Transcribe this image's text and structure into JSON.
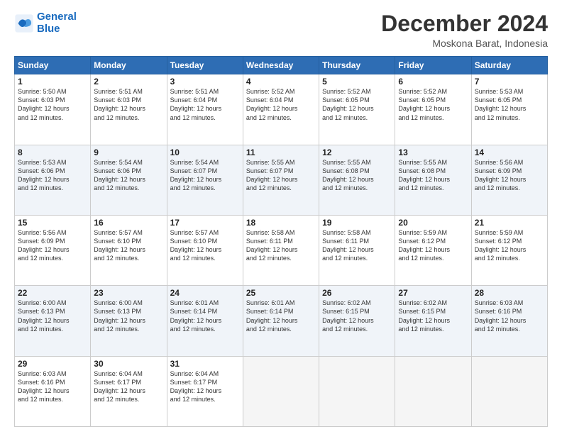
{
  "logo": {
    "line1": "General",
    "line2": "Blue"
  },
  "title": "December 2024",
  "subtitle": "Moskona Barat, Indonesia",
  "days": [
    "Sunday",
    "Monday",
    "Tuesday",
    "Wednesday",
    "Thursday",
    "Friday",
    "Saturday"
  ],
  "weeks": [
    [
      {
        "day": "1",
        "sunrise": "5:50 AM",
        "sunset": "6:03 PM",
        "daylight": "12 hours and 12 minutes."
      },
      {
        "day": "2",
        "sunrise": "5:51 AM",
        "sunset": "6:03 PM",
        "daylight": "12 hours and 12 minutes."
      },
      {
        "day": "3",
        "sunrise": "5:51 AM",
        "sunset": "6:04 PM",
        "daylight": "12 hours and 12 minutes."
      },
      {
        "day": "4",
        "sunrise": "5:52 AM",
        "sunset": "6:04 PM",
        "daylight": "12 hours and 12 minutes."
      },
      {
        "day": "5",
        "sunrise": "5:52 AM",
        "sunset": "6:05 PM",
        "daylight": "12 hours and 12 minutes."
      },
      {
        "day": "6",
        "sunrise": "5:52 AM",
        "sunset": "6:05 PM",
        "daylight": "12 hours and 12 minutes."
      },
      {
        "day": "7",
        "sunrise": "5:53 AM",
        "sunset": "6:05 PM",
        "daylight": "12 hours and 12 minutes."
      }
    ],
    [
      {
        "day": "8",
        "sunrise": "5:53 AM",
        "sunset": "6:06 PM",
        "daylight": "12 hours and 12 minutes."
      },
      {
        "day": "9",
        "sunrise": "5:54 AM",
        "sunset": "6:06 PM",
        "daylight": "12 hours and 12 minutes."
      },
      {
        "day": "10",
        "sunrise": "5:54 AM",
        "sunset": "6:07 PM",
        "daylight": "12 hours and 12 minutes."
      },
      {
        "day": "11",
        "sunrise": "5:55 AM",
        "sunset": "6:07 PM",
        "daylight": "12 hours and 12 minutes."
      },
      {
        "day": "12",
        "sunrise": "5:55 AM",
        "sunset": "6:08 PM",
        "daylight": "12 hours and 12 minutes."
      },
      {
        "day": "13",
        "sunrise": "5:55 AM",
        "sunset": "6:08 PM",
        "daylight": "12 hours and 12 minutes."
      },
      {
        "day": "14",
        "sunrise": "5:56 AM",
        "sunset": "6:09 PM",
        "daylight": "12 hours and 12 minutes."
      }
    ],
    [
      {
        "day": "15",
        "sunrise": "5:56 AM",
        "sunset": "6:09 PM",
        "daylight": "12 hours and 12 minutes."
      },
      {
        "day": "16",
        "sunrise": "5:57 AM",
        "sunset": "6:10 PM",
        "daylight": "12 hours and 12 minutes."
      },
      {
        "day": "17",
        "sunrise": "5:57 AM",
        "sunset": "6:10 PM",
        "daylight": "12 hours and 12 minutes."
      },
      {
        "day": "18",
        "sunrise": "5:58 AM",
        "sunset": "6:11 PM",
        "daylight": "12 hours and 12 minutes."
      },
      {
        "day": "19",
        "sunrise": "5:58 AM",
        "sunset": "6:11 PM",
        "daylight": "12 hours and 12 minutes."
      },
      {
        "day": "20",
        "sunrise": "5:59 AM",
        "sunset": "6:12 PM",
        "daylight": "12 hours and 12 minutes."
      },
      {
        "day": "21",
        "sunrise": "5:59 AM",
        "sunset": "6:12 PM",
        "daylight": "12 hours and 12 minutes."
      }
    ],
    [
      {
        "day": "22",
        "sunrise": "6:00 AM",
        "sunset": "6:13 PM",
        "daylight": "12 hours and 12 minutes."
      },
      {
        "day": "23",
        "sunrise": "6:00 AM",
        "sunset": "6:13 PM",
        "daylight": "12 hours and 12 minutes."
      },
      {
        "day": "24",
        "sunrise": "6:01 AM",
        "sunset": "6:14 PM",
        "daylight": "12 hours and 12 minutes."
      },
      {
        "day": "25",
        "sunrise": "6:01 AM",
        "sunset": "6:14 PM",
        "daylight": "12 hours and 12 minutes."
      },
      {
        "day": "26",
        "sunrise": "6:02 AM",
        "sunset": "6:15 PM",
        "daylight": "12 hours and 12 minutes."
      },
      {
        "day": "27",
        "sunrise": "6:02 AM",
        "sunset": "6:15 PM",
        "daylight": "12 hours and 12 minutes."
      },
      {
        "day": "28",
        "sunrise": "6:03 AM",
        "sunset": "6:16 PM",
        "daylight": "12 hours and 12 minutes."
      }
    ],
    [
      {
        "day": "29",
        "sunrise": "6:03 AM",
        "sunset": "6:16 PM",
        "daylight": "12 hours and 12 minutes."
      },
      {
        "day": "30",
        "sunrise": "6:04 AM",
        "sunset": "6:17 PM",
        "daylight": "12 hours and 12 minutes."
      },
      {
        "day": "31",
        "sunrise": "6:04 AM",
        "sunset": "6:17 PM",
        "daylight": "12 hours and 12 minutes."
      },
      null,
      null,
      null,
      null
    ]
  ],
  "labels": {
    "sunrise": "Sunrise:",
    "sunset": "Sunset:",
    "daylight": "Daylight:"
  }
}
